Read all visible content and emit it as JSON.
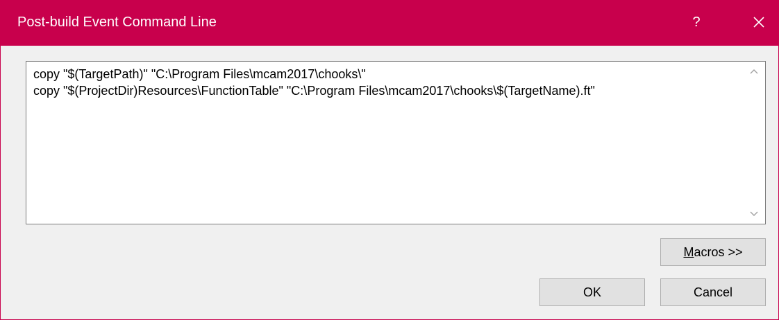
{
  "window": {
    "title": "Post-build Event Command Line",
    "help_label": "?",
    "close_icon": "close-icon",
    "accent_color": "#c8004c"
  },
  "editor": {
    "lines": [
      "copy \"$(TargetPath)\" \"C:\\Program Files\\mcam2017\\chooks\\\"",
      "copy \"$(ProjectDir)Resources\\FunctionTable\" \"C:\\Program Files\\mcam2017\\chooks\\$(TargetName).ft\""
    ],
    "scroll_up_icon": "chevron-up-icon",
    "scroll_down_icon": "chevron-down-icon"
  },
  "buttons": {
    "macros_mnemonic": "M",
    "macros_rest": "acros >>",
    "ok_label": "OK",
    "cancel_label": "Cancel"
  }
}
